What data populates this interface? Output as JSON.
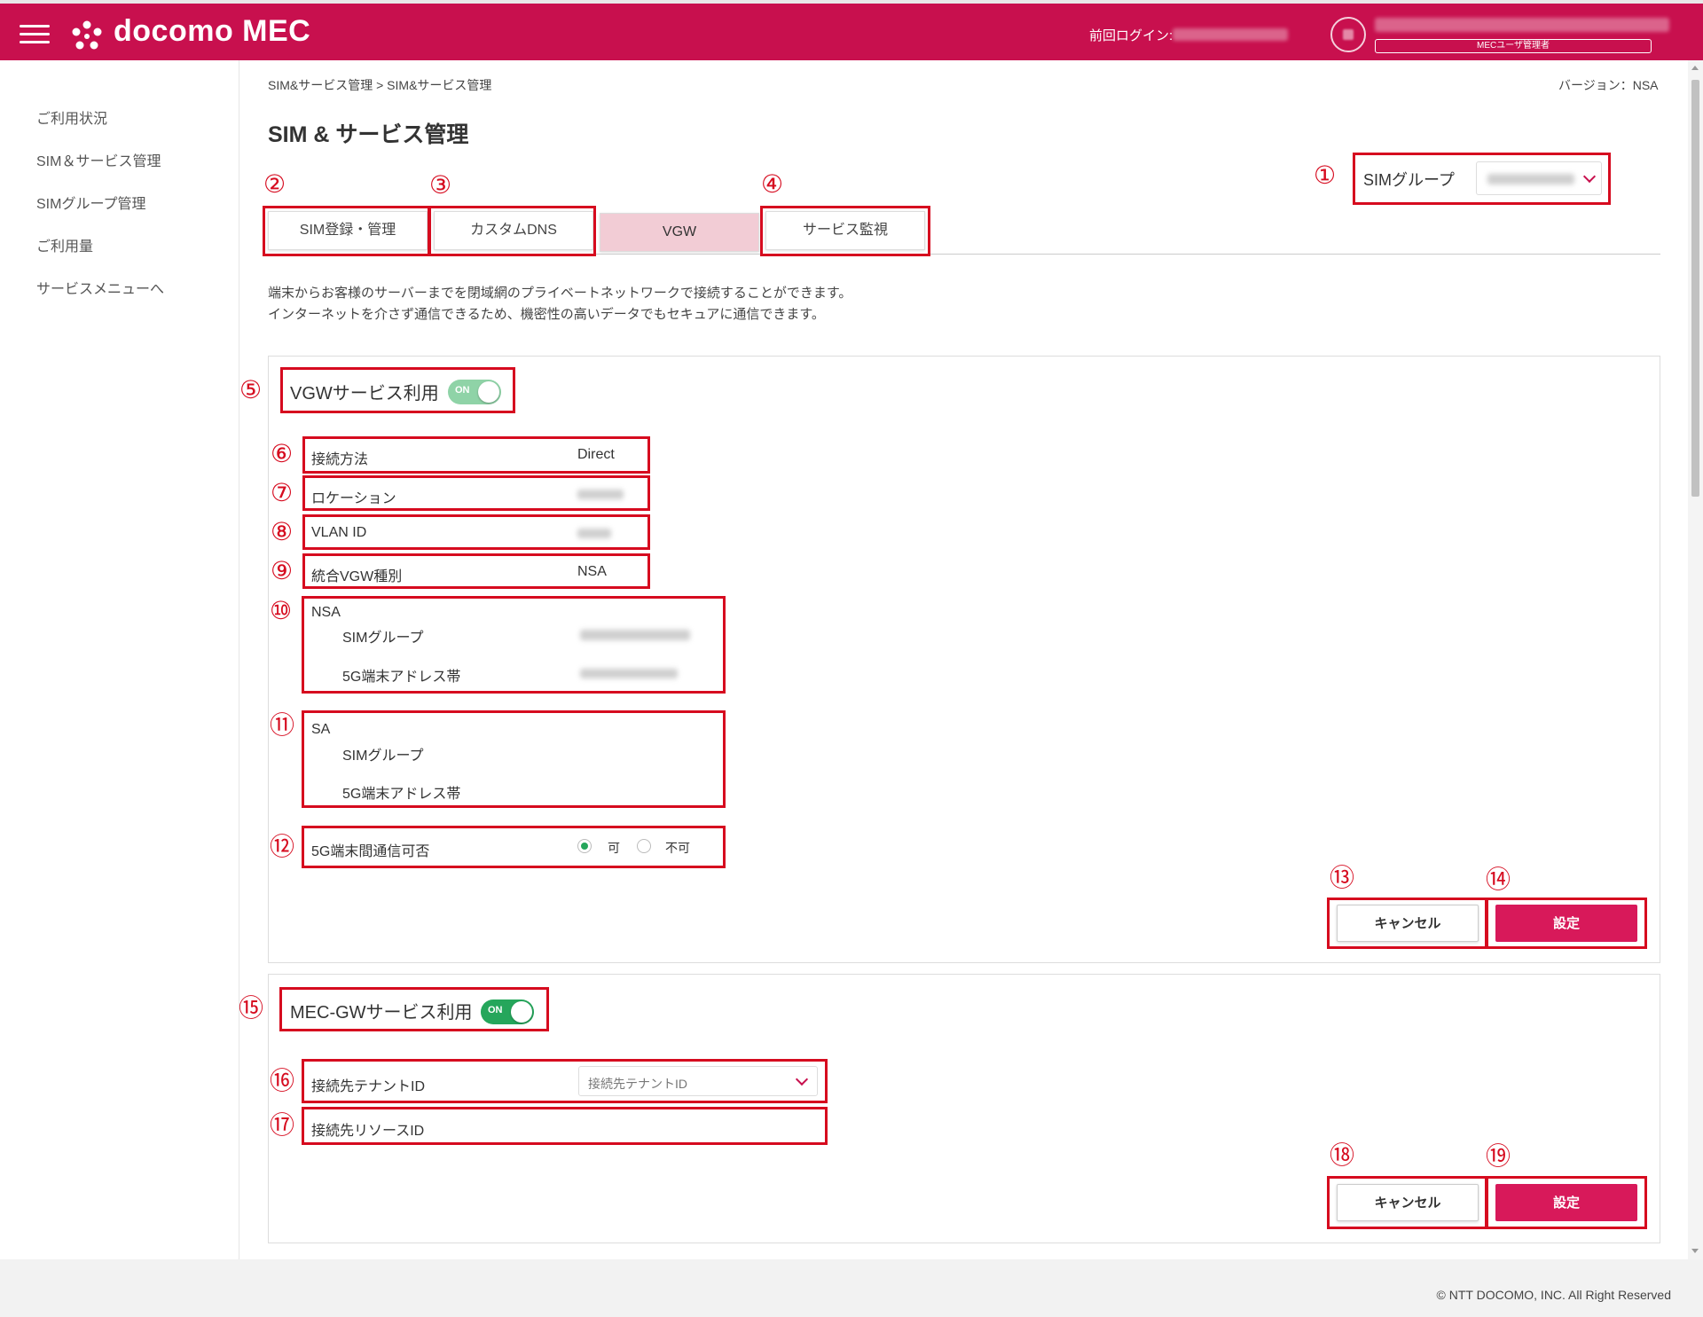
{
  "header": {
    "brand": "docomo MEC",
    "last_login_label": "前回ログイン:",
    "role_badge": "MECユーザ管理者"
  },
  "sidebar": {
    "items": [
      {
        "label": "ご利用状況"
      },
      {
        "label": "SIM＆サービス管理"
      },
      {
        "label": "SIMグループ管理"
      },
      {
        "label": "ご利用量"
      },
      {
        "label": "サービスメニューへ"
      }
    ]
  },
  "breadcrumb": "SIM&サービス管理 > SIM&サービス管理",
  "version": "バージョン：NSA",
  "page_title": "SIM & サービス管理",
  "sim_group": {
    "label": "SIMグループ"
  },
  "tabs": [
    {
      "label": "SIM登録・管理"
    },
    {
      "label": "カスタムDNS"
    },
    {
      "label": "VGW"
    },
    {
      "label": "サービス監視"
    }
  ],
  "description": {
    "line1": "端末からお客様のサーバーまでを閉域網のプライベートネットワークで接続することができます。",
    "line2": "インターネットを介さず通信できるため、機密性の高いデータでもセキュアに通信できます。"
  },
  "vgw": {
    "title": "VGWサービス利用",
    "toggle_label": "ON",
    "connection_method_label": "接続方法",
    "connection_method_value": "Direct",
    "location_label": "ロケーション",
    "vlan_label": "VLAN ID",
    "vgw_type_label": "統合VGW種別",
    "vgw_type_value": "NSA",
    "nsa_label": "NSA",
    "nsa_sim_group_label": "SIMグループ",
    "nsa_addr_label": "5G端末アドレス帯",
    "sa_label": "SA",
    "sa_sim_group_label": "SIMグループ",
    "sa_addr_label": "5G端末アドレス帯",
    "comm_label": "5G端末間通信可否",
    "comm_yes": "可",
    "comm_no": "不可",
    "cancel": "キャンセル",
    "set": "設定"
  },
  "mecgw": {
    "title": "MEC-GWサービス利用",
    "toggle_label": "ON",
    "tenant_label": "接続先テナントID",
    "tenant_placeholder": "接続先テナントID",
    "resource_label": "接続先リソースID",
    "cancel": "キャンセル",
    "set": "設定"
  },
  "annotations": [
    "①",
    "②",
    "③",
    "④",
    "⑤",
    "⑥",
    "⑦",
    "⑧",
    "⑨",
    "⑩",
    "⑪",
    "⑫",
    "⑬",
    "⑭",
    "⑮",
    "⑯",
    "⑰",
    "⑱",
    "⑲"
  ],
  "footer": {
    "copyright": "© NTT DOCOMO, INC. All Right Reserved"
  },
  "colors": {
    "brand": "#c8104e",
    "annotation_red": "#d60b1f",
    "toggle_green": "#25a65b",
    "active_tab": "#f2ccd5",
    "set_button": "#d8195a"
  }
}
